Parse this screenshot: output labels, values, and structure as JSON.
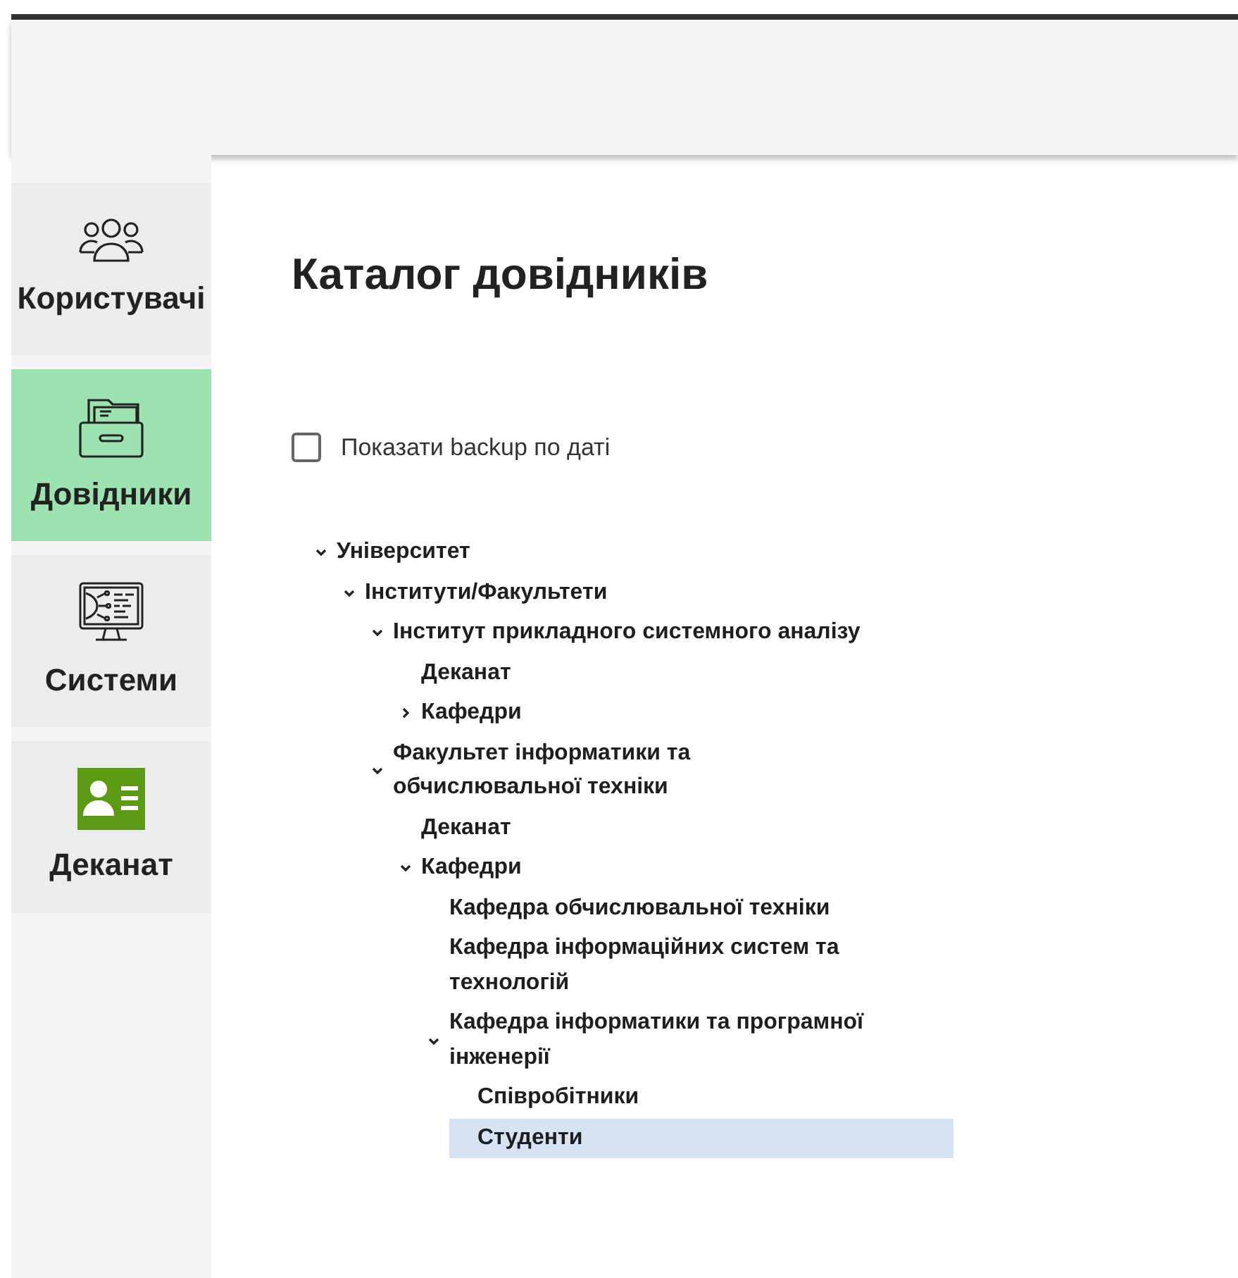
{
  "sidebar": {
    "items": [
      {
        "label": "Користувачі",
        "selected": false
      },
      {
        "label": "Довідники",
        "selected": true
      },
      {
        "label": "Системи",
        "selected": false
      },
      {
        "label": "Деканат",
        "selected": false
      }
    ]
  },
  "page_title": "Каталог довідників",
  "backup_checkbox": {
    "label": "Показати backup по даті",
    "checked": false
  },
  "tree": [
    {
      "label": "Університет",
      "expanded": true,
      "selected": false,
      "children": [
        {
          "label": "Інститути/Факультети",
          "expanded": true,
          "selected": false,
          "children": [
            {
              "label": "Інститут прикладного системного аналізу",
              "expanded": true,
              "selected": false,
              "children": [
                {
                  "label": "Деканат",
                  "selected": false
                },
                {
                  "label": "Кафедри",
                  "expanded": false,
                  "selected": false
                }
              ]
            },
            {
              "label": "Факультет інформатики та обчислювальної техніки",
              "expanded": true,
              "selected": false,
              "children": [
                {
                  "label": "Деканат",
                  "selected": false
                },
                {
                  "label": "Кафедри",
                  "expanded": true,
                  "selected": false,
                  "children": [
                    {
                      "label": "Кафедра обчислювальної техніки",
                      "selected": false
                    },
                    {
                      "label": "Кафедра інформаційних систем та технологій",
                      "selected": false
                    },
                    {
                      "label": "Кафедра інформатики та програмної інженерії",
                      "expanded": true,
                      "selected": false,
                      "children": [
                        {
                          "label": "Співробітники",
                          "selected": false
                        },
                        {
                          "label": "Студенти",
                          "selected": true
                        }
                      ]
                    }
                  ]
                }
              ]
            }
          ]
        }
      ]
    }
  ]
}
